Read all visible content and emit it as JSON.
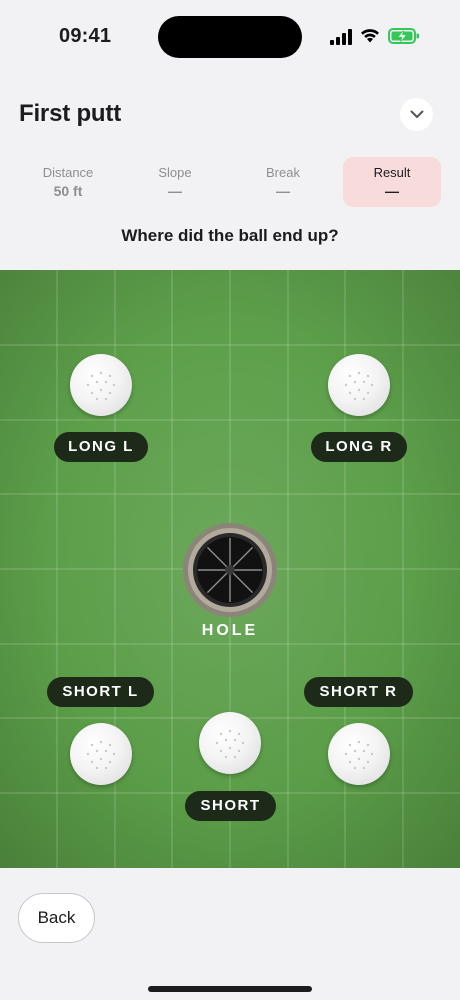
{
  "status_bar": {
    "time": "09:41",
    "icons": [
      "signal-icon",
      "wifi-icon",
      "battery-charging-icon"
    ]
  },
  "header": {
    "title": "First putt",
    "collapse_icon": "chevron-down-icon"
  },
  "tabs": [
    {
      "label": "Distance",
      "value": "50 ft"
    },
    {
      "label": "Slope",
      "value": "—"
    },
    {
      "label": "Break",
      "value": "—"
    },
    {
      "label": "Result",
      "value": "—"
    }
  ],
  "active_tab": "Result",
  "question": "Where did the ball end up?",
  "green": {
    "options": {
      "long_l": "LONG L",
      "long_r": "LONG R",
      "short_l": "SHORT L",
      "short_r": "SHORT R",
      "short": "SHORT"
    },
    "hole_label": "HOLE"
  },
  "footer": {
    "back_label": "Back"
  },
  "colors": {
    "accent_tab_bg": "#f8dcdc",
    "green": "#5ea14b",
    "pill_bg": "#1d2a1a",
    "background": "#f2f2f4"
  }
}
